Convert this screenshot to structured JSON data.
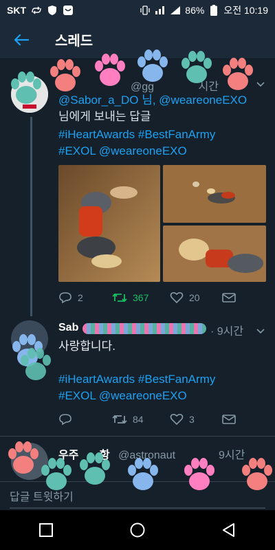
{
  "status_bar": {
    "carrier": "SKT",
    "battery": "86%",
    "time": "오전 10:19"
  },
  "header": {
    "title": "스레드"
  },
  "tweet1": {
    "handle_partial": "@gg",
    "time_partial": "시간",
    "line1": "@Sabor_a_DO 님, @weareoneEXO",
    "line2": "님에게 보내는 답글",
    "line3": "#iHeartAwards #BestFanArmy",
    "line4": "#EXOL @weareoneEXO",
    "actions": {
      "replies": "2",
      "retweets": "367",
      "likes": "20"
    }
  },
  "tweet2": {
    "name_partial": "Sab",
    "time": "· 9시간",
    "line1": "사랑합니다.",
    "line3": "#iHeartAwards #BestFanArmy",
    "line4": "#EXOL @weareoneEXO",
    "actions": {
      "retweets": "84",
      "likes": "3"
    }
  },
  "tweet3": {
    "name_partial": "우주",
    "name_partial2": "항",
    "handle_partial": "@astronaut",
    "time_partial": "9시간"
  },
  "reply_bar": {
    "placeholder": "답글 트윗하기"
  },
  "colors": {
    "background": "#15202b",
    "accent": "#1da1f2",
    "retweet_active": "#17bf63",
    "muted": "#8899a6"
  }
}
